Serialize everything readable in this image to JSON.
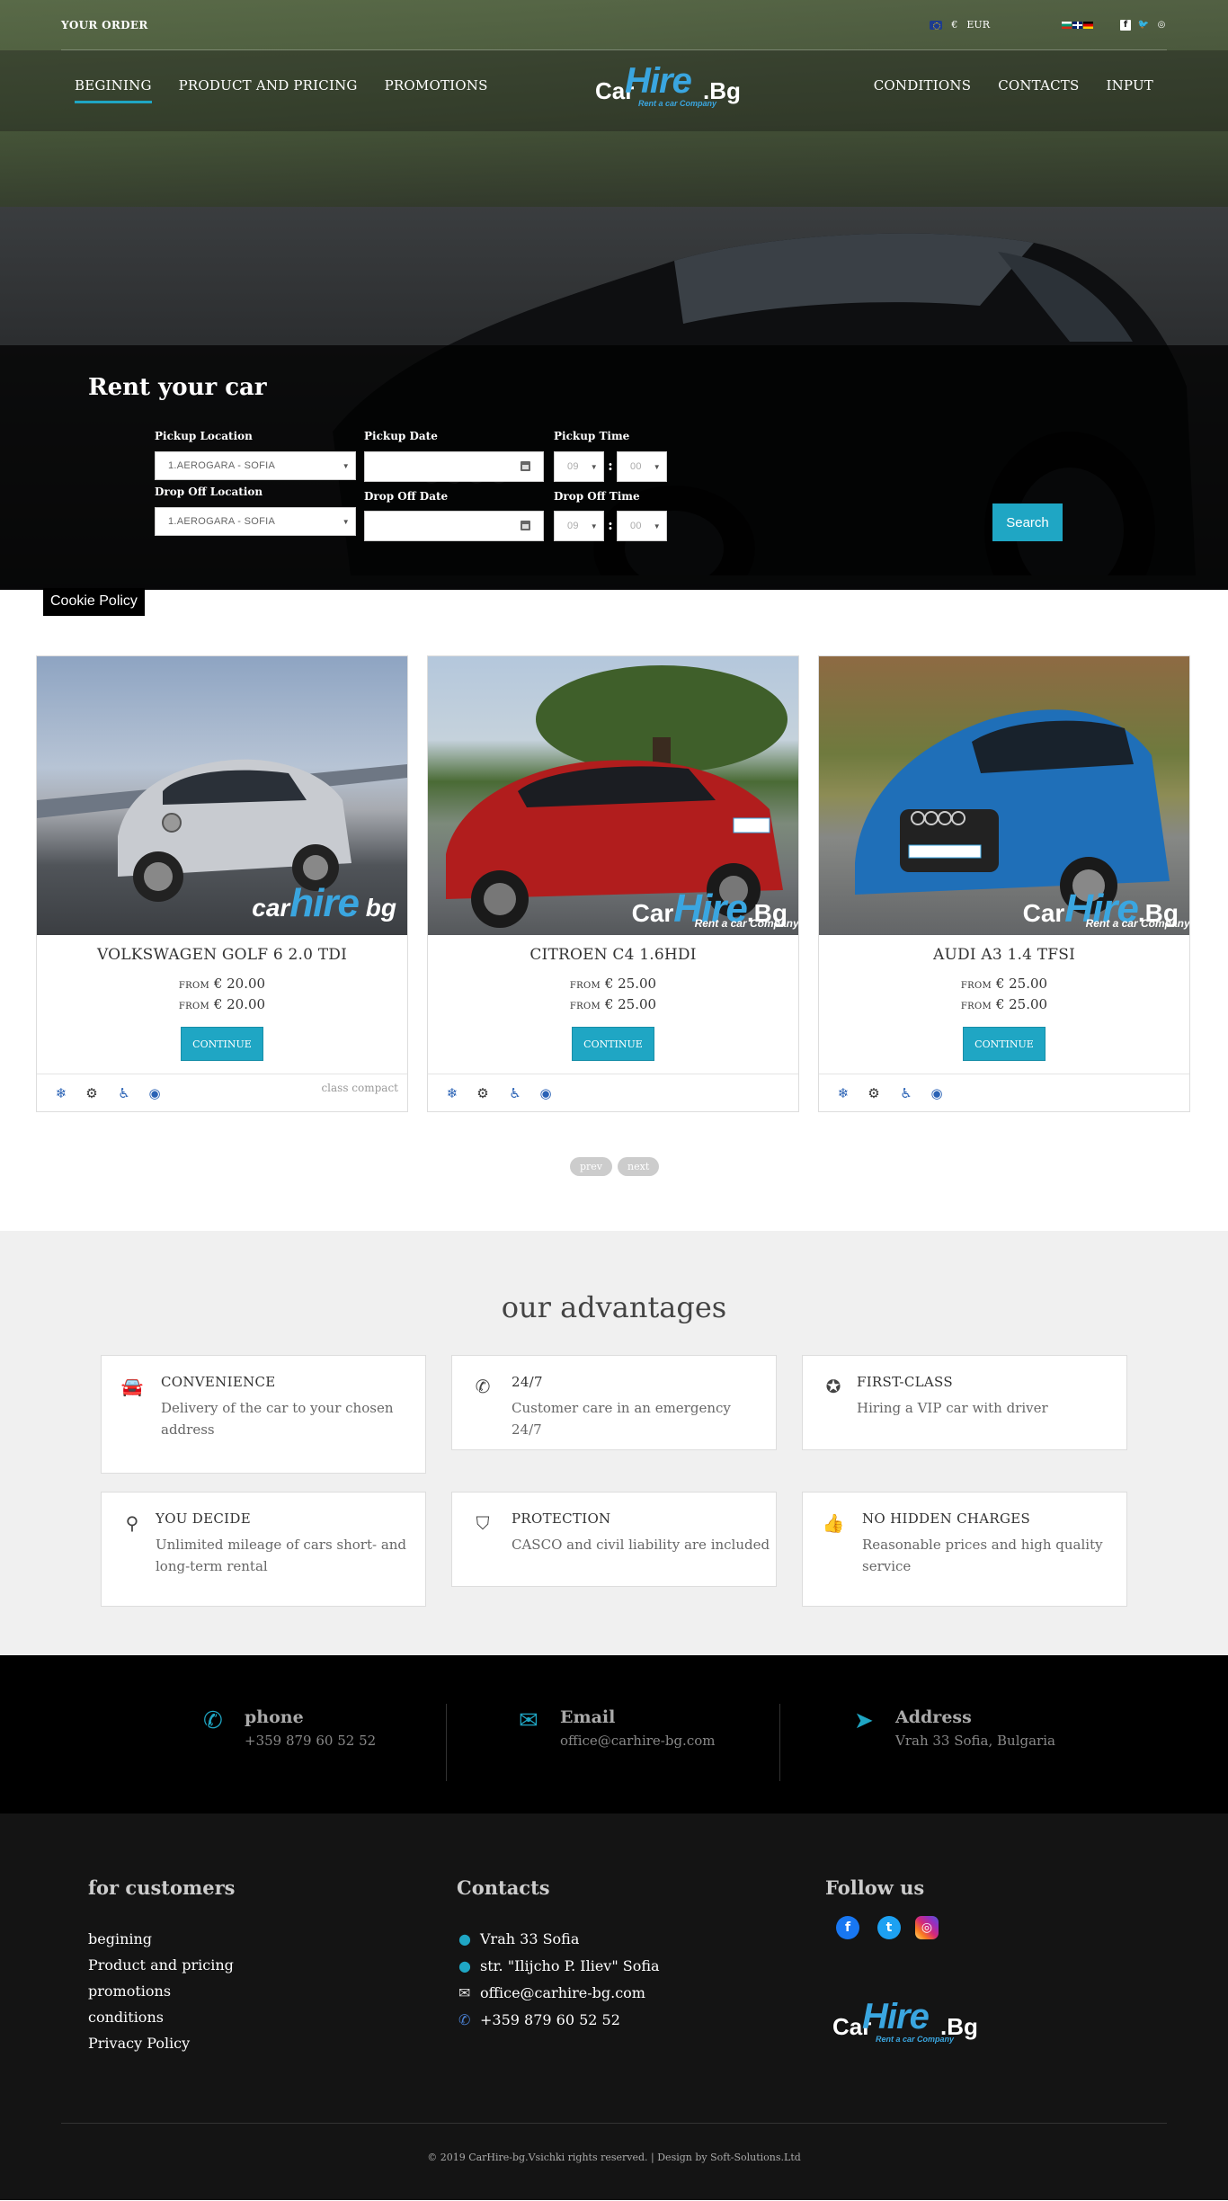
{
  "topbar": {
    "order_label": "YOUR ORDER",
    "currency_symbol": "€",
    "currency_code": "EUR"
  },
  "nav": {
    "left": [
      "BEGINING",
      "PRODUCT AND PRICING",
      "PROMOTIONS"
    ],
    "right": [
      "CONDITIONS",
      "CONTACTS",
      "INPUT"
    ],
    "active": "BEGINING"
  },
  "logo": {
    "car": "Car",
    "hire": "Hire",
    "bg": ".Bg",
    "tagline": "Rent a car Company"
  },
  "booking": {
    "title": "Rent your car",
    "pickup_location_label": "Pickup Location",
    "pickup_location_value": "1.AEROGARA - SOFIA",
    "dropoff_location_label": "Drop Off Location",
    "dropoff_location_value": "1.AEROGARA - SOFIA",
    "pickup_date_label": "Pickup Date",
    "dropoff_date_label": "Drop Off Date",
    "pickup_time_label": "Pickup Time",
    "dropoff_time_label": "Drop Off Time",
    "pickup_hour": "09",
    "pickup_minute": "00",
    "dropoff_hour": "09",
    "dropoff_minute": "00",
    "search_label": "Search"
  },
  "cookie_label": "Cookie Policy",
  "cars": [
    {
      "name": "VOLKSWAGEN GOLF 6 2.0 TDI",
      "from1": "FROM",
      "price1": "€ 20.00",
      "from2": "FROM",
      "price2": "€ 20.00",
      "button": "CONTINUE",
      "class": "class compact"
    },
    {
      "name": "CITROEN C4 1.6HDI",
      "from1": "FROM",
      "price1": "€ 25.00",
      "from2": "FROM",
      "price2": "€ 25.00",
      "button": "CONTINUE",
      "class": ""
    },
    {
      "name": "AUDI A3 1.4 TFSI",
      "from1": "FROM",
      "price1": "€ 25.00",
      "from2": "FROM",
      "price2": "€ 25.00",
      "button": "CONTINUE",
      "class": ""
    }
  ],
  "watermark": {
    "golf_c": "car",
    "golf_h": "hire",
    "golf_b": " bg",
    "golf_t": "Rent a car company"
  },
  "pager": {
    "prev": "prev",
    "next": "next"
  },
  "advantages": {
    "title": "our advantages",
    "items": [
      {
        "icon": "car-icon",
        "title": "CONVENIENCE",
        "text": "Delivery of the car to your chosen address"
      },
      {
        "icon": "phone-icon",
        "title": "24/7",
        "text": "Customer care in an emergency 24/7"
      },
      {
        "icon": "award-icon",
        "title": "FIRST-CLASS",
        "text": "Hiring a VIP car with driver"
      },
      {
        "icon": "map-pin-icon",
        "title": "YOU DECIDE",
        "text": "Unlimited mileage of cars short- and long-term rental"
      },
      {
        "icon": "shield-icon",
        "title": "PROTECTION",
        "text": "CASCO and civil liability are included"
      },
      {
        "icon": "thumbs-up-icon",
        "title": "NO HIDDEN CHARGES",
        "text": "Reasonable prices and high quality service"
      }
    ]
  },
  "strip": {
    "phone_title": "phone",
    "phone_value": "+359 879 60 52 52",
    "email_title": "Email",
    "email_value": "office@carhire-bg.com",
    "address_title": "Address",
    "address_value": "Vrah 33 Sofia, Bulgaria"
  },
  "footer": {
    "customers_title": "for customers",
    "customer_links": [
      "begining",
      "Product and pricing",
      "promotions",
      "conditions",
      "Privacy Policy"
    ],
    "contacts_title": "Contacts",
    "contact_lines": [
      "Vrah 33 Sofia",
      "str. \"Ilijcho P. Iliev\" Sofia",
      "office@carhire-bg.com",
      "+359 879 60 52 52"
    ],
    "follow_title": "Follow us",
    "copyright": "© 2019 CarHire-bg.Vsichki rights reserved. | Design by Soft-Solutions.Ltd"
  },
  "colors": {
    "accent": "#1fa6c4",
    "brand_blue": "#3aa6e0",
    "dark": "#141414"
  }
}
